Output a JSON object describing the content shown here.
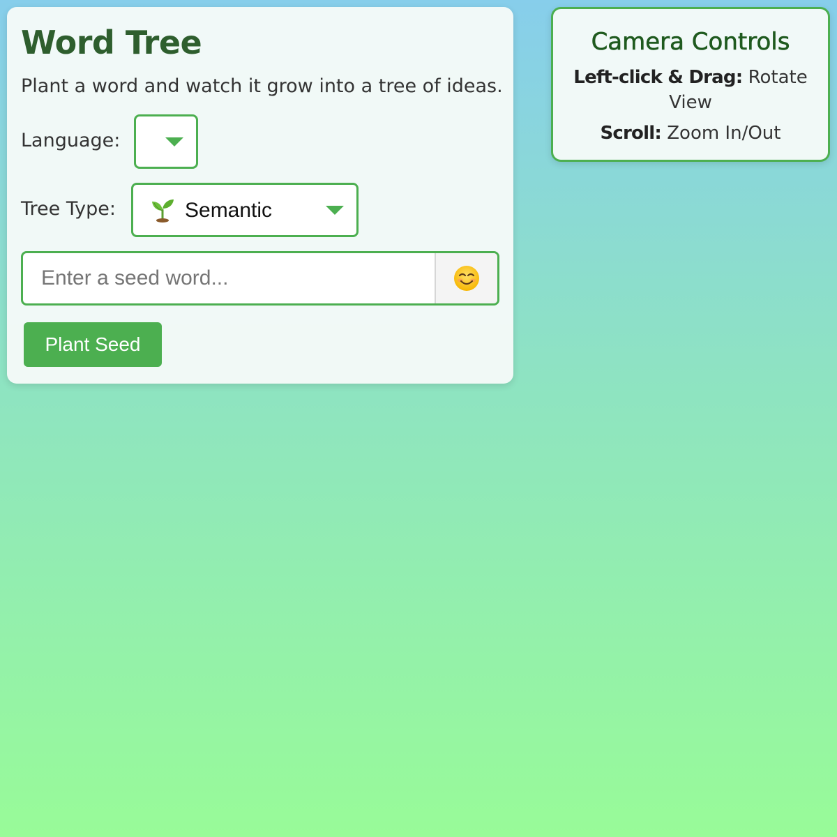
{
  "app": {
    "title": "Word Tree",
    "subtitle": "Plant a word and watch it grow into a tree of ideas."
  },
  "controls": {
    "language_label": "Language:",
    "language_value": "",
    "tree_type_label": "Tree Type:",
    "tree_type_value": "Semantic",
    "tree_type_icon": "seedling-icon",
    "seed_placeholder": "Enter a seed word...",
    "seed_value": "",
    "emoji_button_icon": "smiling-face-icon",
    "plant_button_label": "Plant Seed"
  },
  "camera": {
    "title": "Camera Controls",
    "rotate_key": "Left-click & Drag:",
    "rotate_action": "Rotate View",
    "zoom_key": "Scroll:",
    "zoom_action": "Zoom In/Out"
  },
  "colors": {
    "accent": "#4caf50",
    "title": "#2e5e2e",
    "background_top": "#87ceeb",
    "background_bottom": "#98fb98"
  }
}
